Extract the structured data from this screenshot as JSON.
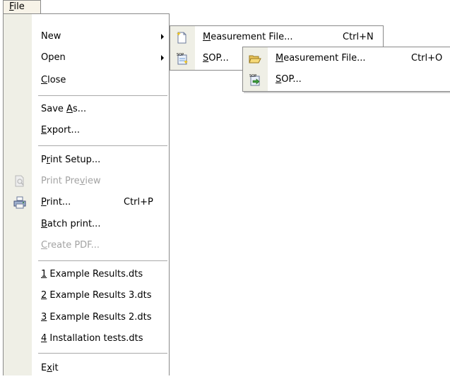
{
  "menubar": {
    "file_label": "File",
    "file_mnemonic": "F",
    "file_rest": "ile"
  },
  "file_menu": {
    "new": {
      "label": "New"
    },
    "open": {
      "label": "Open"
    },
    "close": {
      "mn": "C",
      "rest": "lose"
    },
    "save_as": {
      "pre": "Save ",
      "mn": "A",
      "rest": "s..."
    },
    "export": {
      "mn": "E",
      "rest": "xport..."
    },
    "print_setup": {
      "pre": "P",
      "mn": "r",
      "rest": "int Setup..."
    },
    "print_preview": {
      "pre": "Print Pre",
      "mn": "v",
      "rest": "iew"
    },
    "print": {
      "mn": "P",
      "rest": "rint...",
      "shortcut": "Ctrl+P"
    },
    "batch_print": {
      "mn": "B",
      "rest": "atch print..."
    },
    "create_pdf": {
      "mn": "C",
      "rest": "reate PDF..."
    },
    "recent": [
      {
        "mn": "1",
        "rest": " Example Results.dts"
      },
      {
        "mn": "2",
        "rest": " Example Results 3.dts"
      },
      {
        "mn": "3",
        "rest": " Example Results 2.dts"
      },
      {
        "mn": "4",
        "rest": " Installation tests.dts"
      }
    ],
    "exit": {
      "pre": "E",
      "mn": "x",
      "rest": "it"
    }
  },
  "new_submenu": {
    "measurement_file": {
      "mn": "M",
      "rest": "easurement File...",
      "shortcut": "Ctrl+N"
    },
    "sop": {
      "mn": "S",
      "rest": "OP..."
    }
  },
  "open_submenu": {
    "measurement_file": {
      "mn": "M",
      "rest": "easurement File...",
      "shortcut": "Ctrl+O"
    },
    "sop": {
      "mn": "S",
      "rest": "OP..."
    }
  },
  "colors": {
    "gutter": "#efefe6",
    "border": "#8a8a8a",
    "disabled": "#a3a3a3"
  }
}
